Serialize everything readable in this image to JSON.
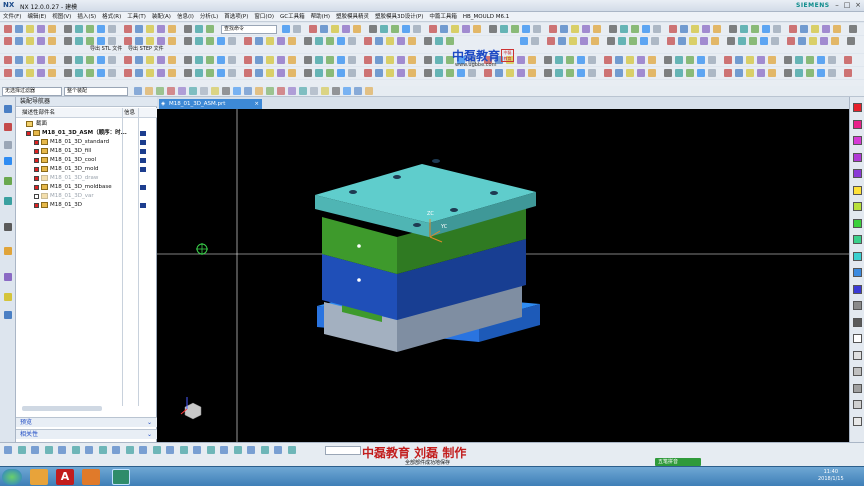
{
  "window": {
    "app_logo": "NX",
    "title": "NX 12.0.0.27 - 建模",
    "brand": "SIEMENS"
  },
  "menu": [
    "文件(F)",
    "编辑(E)",
    "视图(V)",
    "插入(S)",
    "格式(R)",
    "工具(T)",
    "装配(A)",
    "信息(I)",
    "分析(L)",
    "首选项(P)",
    "窗口(O)",
    "GC工具箱",
    "帮助(H)",
    "塑胶模具精灵",
    "塑胶模具3D设计(P)",
    "中篇工具箱",
    "HB_MOULD M6.1"
  ],
  "toolbar": {
    "search_placeholder": "查找命令",
    "export_stl": "导出 STL 文件",
    "export_step": "导出 STEP 文件",
    "logo_main": "中磊教育",
    "logo_url": "www.ugbbe.com",
    "logo_seal": "中磊教育"
  },
  "selection_bar": {
    "filter_value": "无选择过滤器",
    "scope_value": "整个装配"
  },
  "navigator": {
    "title": "装配导航器",
    "col_name": "描述性部件名",
    "col_info": "信息",
    "section_label": "截面",
    "items": [
      {
        "label": "M18_01_3D_ASM（顺序：时...",
        "checked": true,
        "bold": true,
        "muted": false
      },
      {
        "label": "M18_01_3D_standard",
        "checked": true,
        "bold": false,
        "muted": false
      },
      {
        "label": "M18_01_3D_fill",
        "checked": true,
        "bold": false,
        "muted": false
      },
      {
        "label": "M18_01_3D_cool",
        "checked": true,
        "bold": false,
        "muted": false
      },
      {
        "label": "M18_01_3D_mold",
        "checked": true,
        "bold": false,
        "muted": false
      },
      {
        "label": "M18_01_3D_draw",
        "checked": true,
        "bold": false,
        "muted": true
      },
      {
        "label": "M18_01_3D_moldbase",
        "checked": true,
        "bold": false,
        "muted": false
      },
      {
        "label": "M18_01_3D_var",
        "checked": false,
        "bold": false,
        "muted": true
      },
      {
        "label": "M18_01_3D",
        "checked": true,
        "bold": false,
        "muted": false
      }
    ],
    "preview_label": "预览",
    "related_label": "相关性"
  },
  "document_tab": "M18_01_3D_ASM.prt",
  "viewport": {
    "axis_zc": "ZC",
    "axis_yc": "YC"
  },
  "status": {
    "caption": "中磊教育  刘磊  制作",
    "message": "全部部件成功地保存"
  },
  "taskbar": {
    "ime_label": "五笔拼音",
    "time": "11:40",
    "date": "2018/1/15"
  },
  "colors": {
    "plate_top": "#5fcdcc",
    "plate_green": "#3e9a2c",
    "plate_blue": "#1f4fb8",
    "plate_grey": "#9aa8b8",
    "base_blue": "#2877e6"
  }
}
